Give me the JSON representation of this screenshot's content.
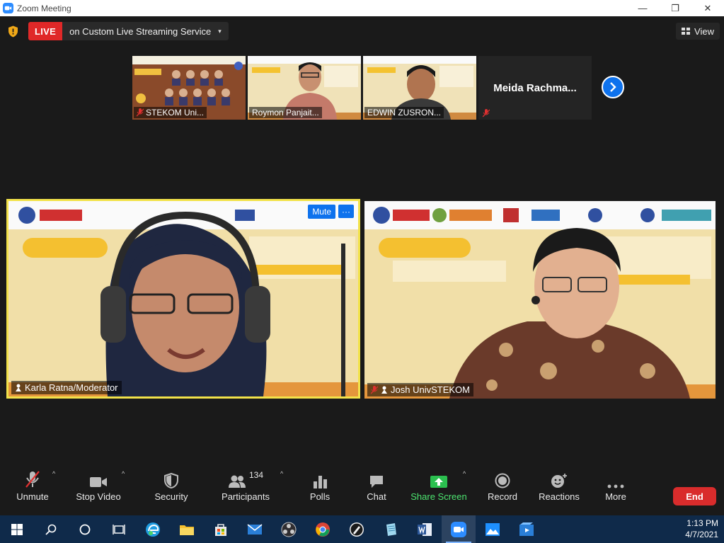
{
  "window": {
    "title": "Zoom Meeting",
    "minimize": "—",
    "maximize": "❐",
    "close": "✕"
  },
  "live": {
    "badge": "LIVE",
    "service": "on Custom Live Streaming Service",
    "caret": "▾"
  },
  "view": {
    "label": "View"
  },
  "strip": {
    "tiles": [
      {
        "name": "STEKOM Uni..."
      },
      {
        "name": "Roymon Panjait..."
      },
      {
        "name": "EDWIN ZUSRON..."
      },
      {
        "name": "Meida  Rachma..."
      }
    ]
  },
  "main": {
    "left": {
      "name": "Karla Ratna/Moderator",
      "mute_label": "Mute",
      "more_label": "···"
    },
    "right": {
      "name": "Josh UnivSTEKOM"
    }
  },
  "toolbar": {
    "unmute": "Unmute",
    "stop_video": "Stop Video",
    "security": "Security",
    "participants": "Participants",
    "participants_count": "134",
    "polls": "Polls",
    "chat": "Chat",
    "share_screen": "Share Screen",
    "record": "Record",
    "reactions": "Reactions",
    "more": "More",
    "end": "End",
    "caret": "^"
  },
  "clock": {
    "time": "1:13 PM",
    "date": "4/7/2021"
  },
  "colors": {
    "live_red": "#e02828",
    "zoom_blue": "#0e72ed",
    "active_speaker": "#f2e24a",
    "share_green": "#4ce36f",
    "end_red": "#d92c2c"
  }
}
